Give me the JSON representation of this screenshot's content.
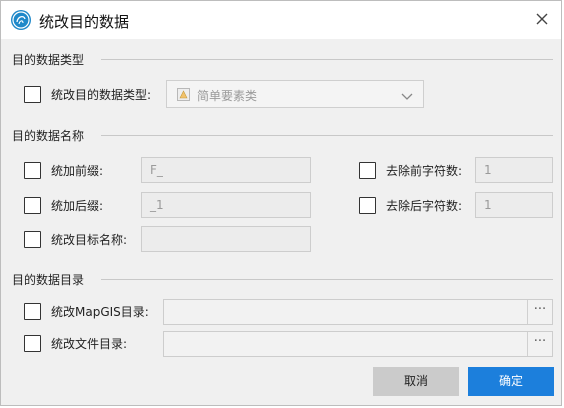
{
  "window": {
    "title": "统改目的数据"
  },
  "sections": {
    "type_header": "目的数据类型",
    "name_header": "目的数据名称",
    "dir_header": "目的数据目录"
  },
  "type_row": {
    "label": "统改目的数据类型:",
    "select_value": "简单要素类",
    "select_icon": "simple-feature-class-icon"
  },
  "name_rows": {
    "prefix_label": "统加前缀:",
    "prefix_value": "F_",
    "suffix_label": "统加后缀:",
    "suffix_value": "_1",
    "rename_label": "统改目标名称:",
    "rename_value": "",
    "remove_prefix_label": "去除前字符数:",
    "remove_prefix_value": "1",
    "remove_suffix_label": "去除后字符数:",
    "remove_suffix_value": "1"
  },
  "dir_rows": {
    "mapgis_label": "统改MapGIS目录:",
    "mapgis_value": "",
    "file_label": "统改文件目录:",
    "file_value": "",
    "browse_label": "···"
  },
  "buttons": {
    "cancel": "取消",
    "ok": "确定"
  },
  "colors": {
    "accent": "#1c7fdc",
    "app_icon": "#1e88c9"
  }
}
